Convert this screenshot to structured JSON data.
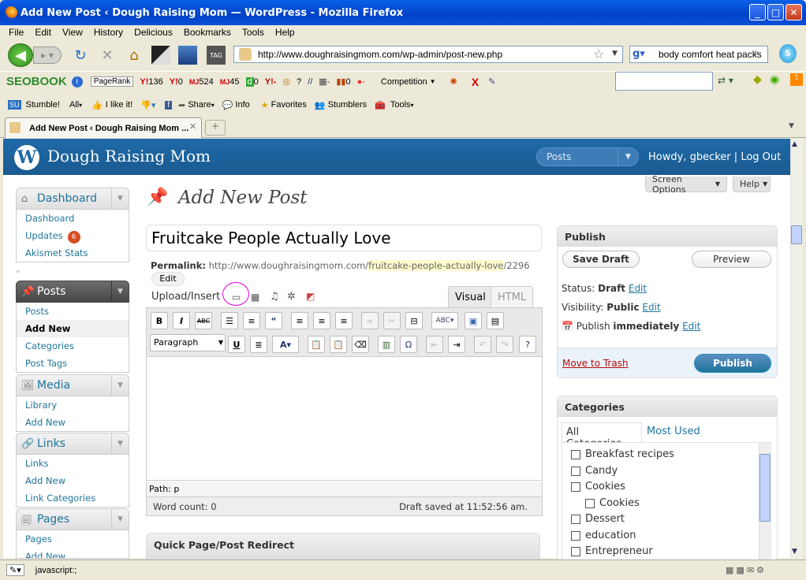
{
  "window": {
    "title": "Add New Post ‹ Dough Raising Mom — WordPress - Mozilla Firefox"
  },
  "menu": [
    "File",
    "Edit",
    "View",
    "History",
    "Delicious",
    "Bookmarks",
    "Tools",
    "Help"
  ],
  "address": {
    "url": "http://www.doughraisingmom.com/wp-admin/post-new.php"
  },
  "search": {
    "value": "body comfort heat packs"
  },
  "seo_toolbar": {
    "brand": "SEOBOOK",
    "pagerank": "PageRank",
    "yahoo": "136",
    "y_count": "0",
    "mj1": "524",
    "mj2": "45",
    "d_count": "0",
    "q": "?",
    "links": "0",
    "competition": "Competition"
  },
  "stumble_toolbar": {
    "stumble": "Stumble!",
    "all": "All",
    "like": "I like it!",
    "share": "Share",
    "info": "Info",
    "favorites": "Favorites",
    "stumblers": "Stumblers",
    "tools": "Tools"
  },
  "tab": {
    "title": "Add New Post ‹ Dough Raising Mom ..."
  },
  "wp": {
    "site_title": "Dough Raising Mom",
    "favorites": "Posts",
    "howdy": "Howdy,",
    "user": "gbecker",
    "sep": "|",
    "logout": "Log Out",
    "screen_options": "Screen Options",
    "help": "Help"
  },
  "sidebar": {
    "dashboard": {
      "label": "Dashboard",
      "items": [
        "Dashboard",
        "Updates",
        "Akismet Stats"
      ],
      "updates_count": "6"
    },
    "posts": {
      "label": "Posts",
      "items": [
        "Posts",
        "Add New",
        "Categories",
        "Post Tags"
      ]
    },
    "media": {
      "label": "Media",
      "items": [
        "Library",
        "Add New"
      ]
    },
    "links": {
      "label": "Links",
      "items": [
        "Links",
        "Add New",
        "Link Categories"
      ]
    },
    "pages": {
      "label": "Pages",
      "items": [
        "Pages",
        "Add New"
      ]
    }
  },
  "editor": {
    "page_title": "Add New Post",
    "post_title": "Fruitcake People Actually Love",
    "permalink_label": "Permalink:",
    "permalink_base": "http://www.doughraisingmom.com/",
    "permalink_slug": "fruitcake-people-actually-love",
    "permalink_id": "/2296",
    "edit": "Edit",
    "upload_insert": "Upload/Insert",
    "tab_visual": "Visual",
    "tab_html": "HTML",
    "format": "Paragraph",
    "path": "Path: p",
    "word_count": "Word count: 0",
    "draft_saved": "Draft saved at 11:52:56 am.",
    "redirect_box": "Quick Page/Post Redirect"
  },
  "publish": {
    "title": "Publish",
    "save_draft": "Save Draft",
    "preview": "Preview",
    "status_label": "Status:",
    "status": "Draft",
    "visibility_label": "Visibility:",
    "visibility": "Public",
    "publish_label": "Publish",
    "publish_when": "immediately",
    "edit": "Edit",
    "trash": "Move to Trash",
    "publish_btn": "Publish"
  },
  "categories": {
    "title": "Categories",
    "tab_all": "All Categories",
    "tab_used": "Most Used",
    "items": [
      "Breakfast recipes",
      "Candy",
      "Cookies",
      "Cookies",
      "Dessert",
      "education",
      "Entrepreneur"
    ]
  },
  "status": {
    "text": "javascript:;"
  }
}
